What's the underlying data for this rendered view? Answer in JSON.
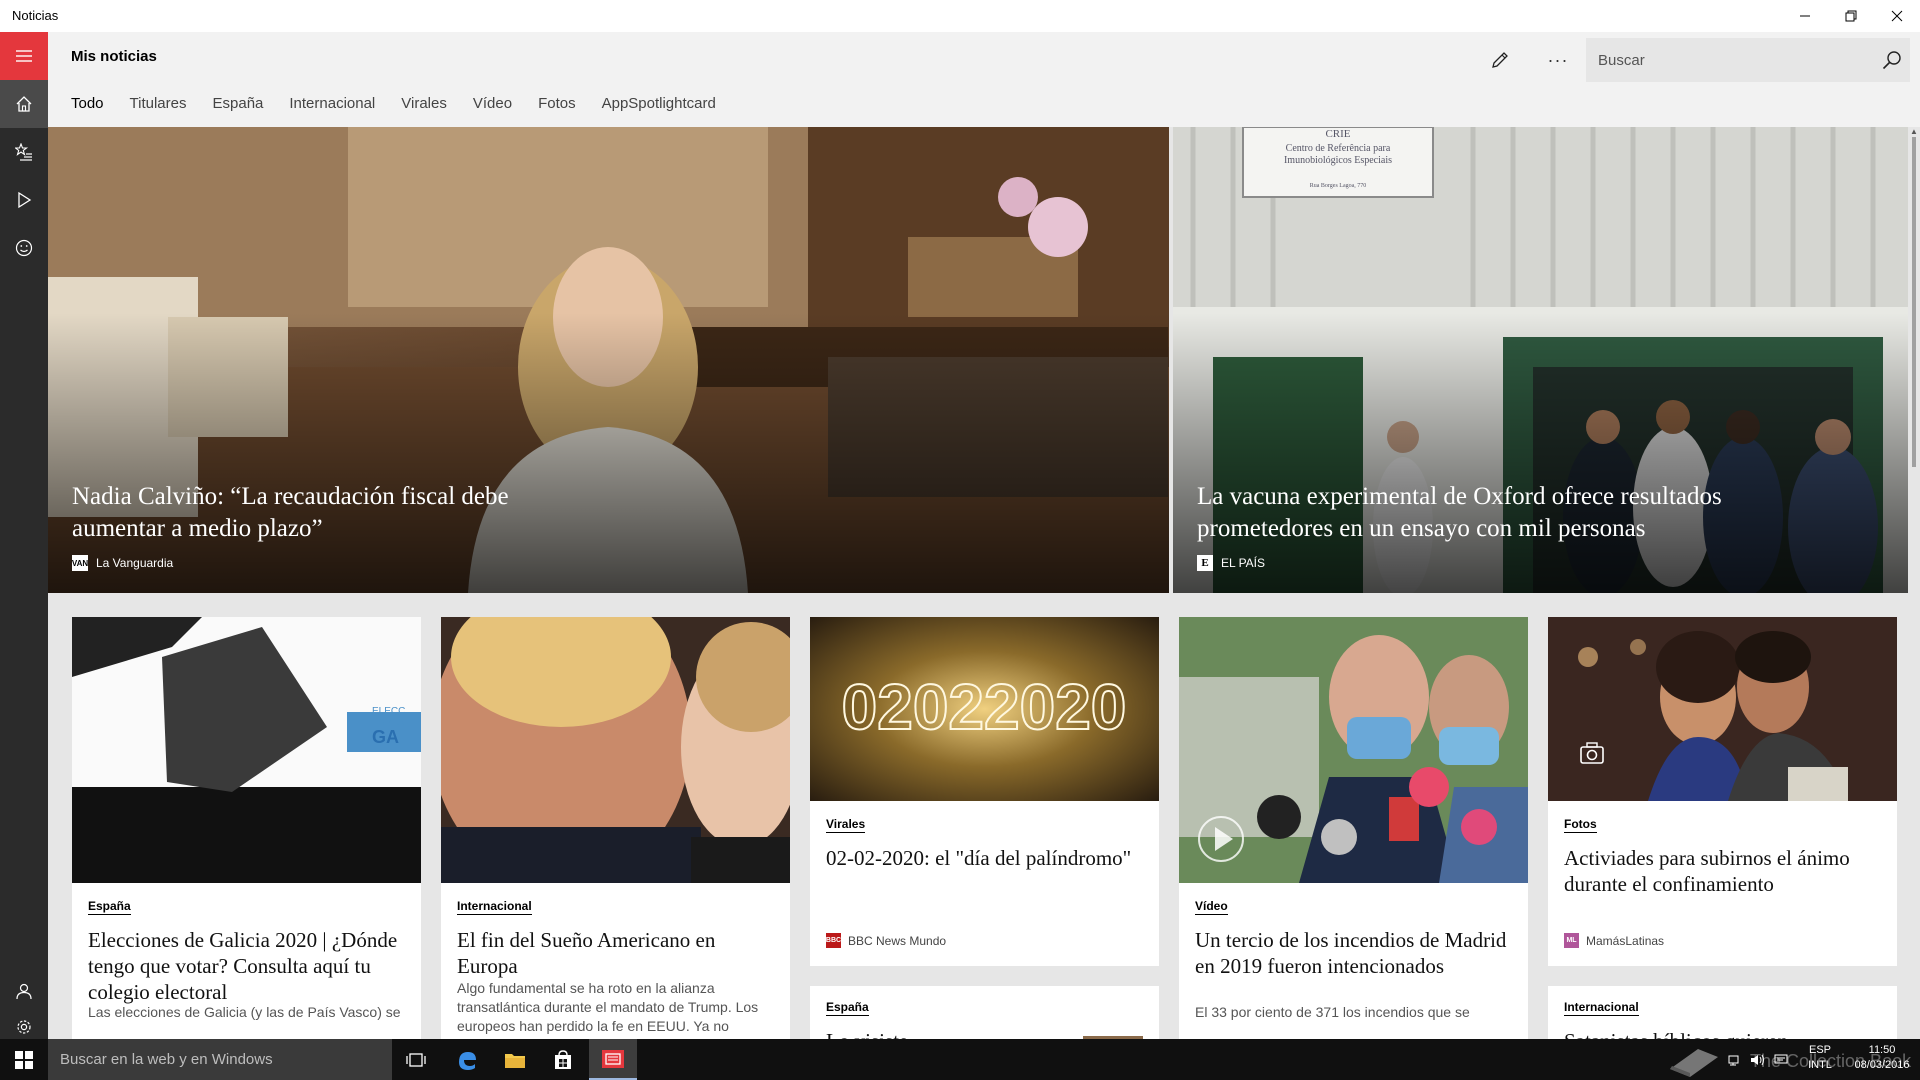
{
  "window": {
    "title": "Noticias"
  },
  "header": {
    "title": "Mis noticias",
    "search_placeholder": "Buscar"
  },
  "tabs": [
    {
      "label": "Todo",
      "active": true
    },
    {
      "label": "Titulares"
    },
    {
      "label": "España"
    },
    {
      "label": "Internacional"
    },
    {
      "label": "Virales"
    },
    {
      "label": "Vídeo"
    },
    {
      "label": "Fotos"
    },
    {
      "label": "AppSpotlightcard"
    }
  ],
  "heroes": [
    {
      "headline": "Nadia Calviño: “La recaudación fiscal debe aumentar a medio plazo”",
      "source": "La Vanguardia",
      "logo": "VAN"
    },
    {
      "headline": "La vacuna experimental de Oxford ofrece resultados prometedores en un ensayo con mil personas",
      "source": "EL PAÍS",
      "logo": "E",
      "image_sign": [
        "CRIE",
        "Centro de Referência para",
        "Imunobiológicos Especiais",
        "Rua Borges Lagoa, 770"
      ]
    }
  ],
  "cards": [
    {
      "category": "España",
      "title": "Elecciones de Galicia 2020 | ¿Dónde tengo que votar? Consulta aquí tu colegio electoral",
      "desc": "Las elecciones de Galicia (y las de País Vasco) se"
    },
    {
      "category": "Internacional",
      "title": "El fin del Sueño Americano en Europa",
      "desc": "Algo fundamental se ha roto en la alianza transatlántica durante el mandato de Trump. Los europeos han perdido la fe en EEUU. Ya no"
    },
    {
      "category": "Virales",
      "title": "02-02-2020: el \"día del palíndromo\"",
      "source": "BBC News Mundo",
      "image_text": "02022020",
      "logo": "BBC"
    },
    {
      "category": "Vídeo",
      "title": "Un tercio de los incendios de Madrid en 2019 fueron intencionados",
      "desc": "El 33 por ciento de 371 los incendios que se"
    },
    {
      "category": "Fotos",
      "title": "Activiades para subirnos el ánimo durante el confinamiento",
      "source": "MamásLatinas",
      "logo": "ML"
    }
  ],
  "lower_cards": [
    {
      "category": "España",
      "title": "Lo visiste"
    },
    {
      "category": "Internacional",
      "title": "Satanistas bíblicos quieren"
    }
  ],
  "taskbar": {
    "search_placeholder": "Buscar en la web y en Windows",
    "lang_top": "ESP",
    "lang_bottom": "INTL",
    "time": "11:50",
    "date": "08/03/2016",
    "watermark": "The Collection Book"
  },
  "colors": {
    "accent": "#e4373d",
    "rail": "#2b2b2b",
    "header": "#f2f2f2"
  }
}
